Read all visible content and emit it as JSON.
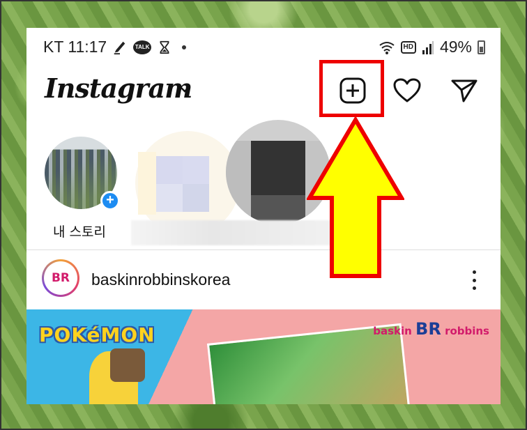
{
  "status_bar": {
    "carrier_time": "KT 11:17",
    "talk_badge": "TALK",
    "hd_badge": "HD",
    "battery": "49%"
  },
  "header": {
    "logo": "Instagram",
    "icons": [
      "chevron-down-icon",
      "new-post-icon",
      "heart-icon",
      "send-icon"
    ]
  },
  "stories": {
    "my_story_label": "내 스토리"
  },
  "post": {
    "username": "baskinrobbinskorea",
    "avatar_logo": "BR",
    "image_text": {
      "pokemon": "POKéMON",
      "brand_left": "baskin",
      "brand_mark": "BR",
      "brand_right": "robbins"
    }
  },
  "annotation": {
    "highlight_color": "#ee0000",
    "arrow_color": "#ffff00"
  }
}
